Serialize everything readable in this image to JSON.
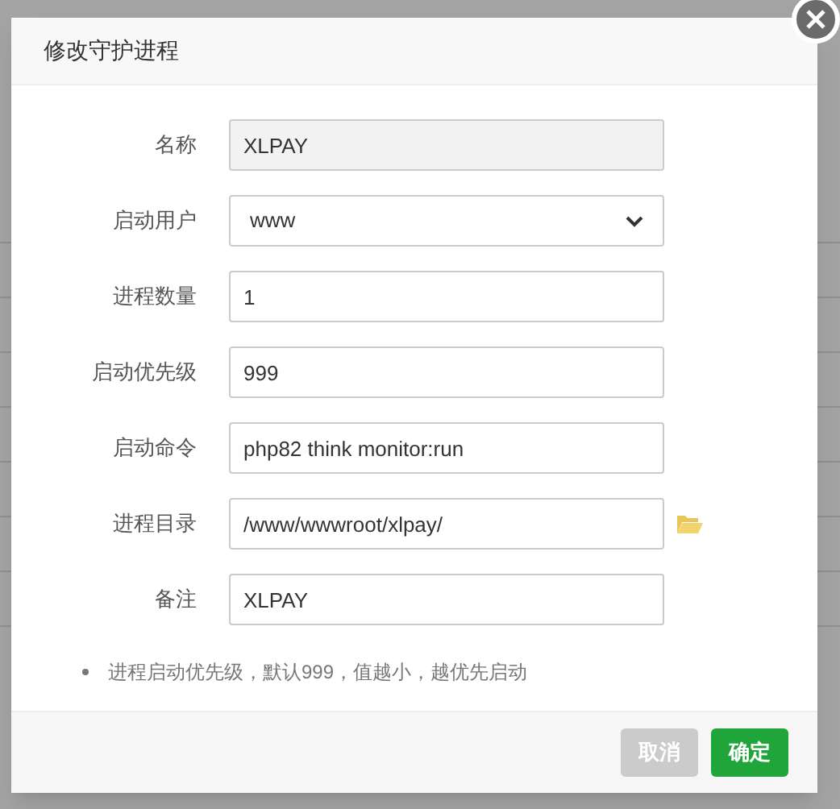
{
  "dialog": {
    "title": "修改守护进程",
    "fields": [
      {
        "label": "名称",
        "kind": "readonly",
        "value": "XLPAY"
      },
      {
        "label": "启动用户",
        "kind": "select",
        "value": "www"
      },
      {
        "label": "进程数量",
        "kind": "text",
        "value": "1"
      },
      {
        "label": "启动优先级",
        "kind": "text",
        "value": "999"
      },
      {
        "label": "启动命令",
        "kind": "text",
        "value": "php82 think monitor:run"
      },
      {
        "label": "进程目录",
        "kind": "folder",
        "value": "/www/wwwroot/xlpay/"
      },
      {
        "label": "备注",
        "kind": "text",
        "value": "XLPAY"
      }
    ],
    "notes": [
      "进程启动优先级，默认999，值越小，越优先启动"
    ],
    "buttons": [
      {
        "label": "取消",
        "kind": "cancel"
      },
      {
        "label": "确定",
        "kind": "primary"
      }
    ]
  }
}
